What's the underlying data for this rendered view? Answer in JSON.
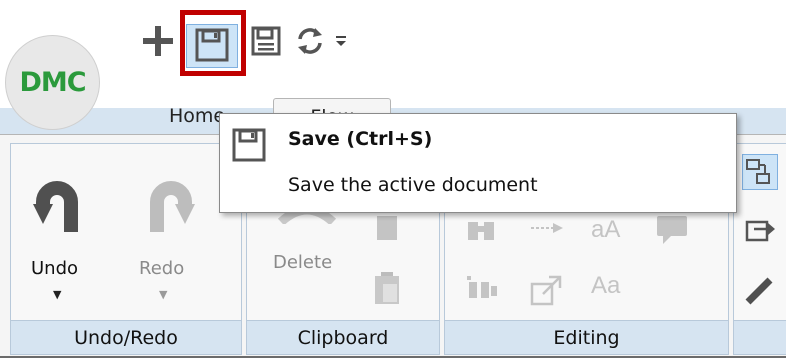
{
  "app": {
    "logo_text": "DMC"
  },
  "quick_access": {
    "items": [
      {
        "name": "new",
        "icon": "plus-icon"
      },
      {
        "name": "save",
        "icon": "save-icon",
        "highlighted": true
      },
      {
        "name": "save-as",
        "icon": "save-as-icon"
      },
      {
        "name": "refresh",
        "icon": "refresh-icon"
      },
      {
        "name": "customize",
        "icon": "customize-dropdown-icon"
      }
    ],
    "highlight_color": "#c00000"
  },
  "tabs": [
    {
      "label": "Home",
      "active": false
    },
    {
      "label": "Flow",
      "active": true
    }
  ],
  "tooltip": {
    "title": "Save (Ctrl+S)",
    "description": "Save the active document",
    "icon": "save-icon"
  },
  "ribbon": {
    "groups": [
      {
        "label": "Undo/Redo",
        "buttons": [
          {
            "label": "Undo",
            "icon": "undo-icon",
            "enabled": true
          },
          {
            "label": "Redo",
            "icon": "redo-icon",
            "enabled": false
          }
        ]
      },
      {
        "label": "Clipboard",
        "buttons": [
          {
            "label": "Delete",
            "icon": "delete-icon",
            "enabled": false
          },
          {
            "label": "",
            "icon": "copy-icon",
            "enabled": false
          },
          {
            "label": "",
            "icon": "paste-icon",
            "enabled": false
          }
        ]
      },
      {
        "label": "Editing",
        "buttons": [
          {
            "label": "",
            "icon": "find-icon",
            "enabled": false
          },
          {
            "label": "",
            "icon": "replace-icon",
            "enabled": false
          },
          {
            "label": "",
            "icon": "font-size-icon",
            "enabled": false
          },
          {
            "label": "",
            "icon": "comment-icon",
            "enabled": false
          },
          {
            "label": "",
            "icon": "find-all-icon",
            "enabled": false
          },
          {
            "label": "",
            "icon": "expand-icon",
            "enabled": false
          },
          {
            "label": "",
            "icon": "change-case-icon",
            "enabled": false
          }
        ]
      }
    ]
  },
  "colors": {
    "accent": "#2b9a3c",
    "ribbon_band": "#d6e4f1",
    "highlight": "#c00000"
  }
}
